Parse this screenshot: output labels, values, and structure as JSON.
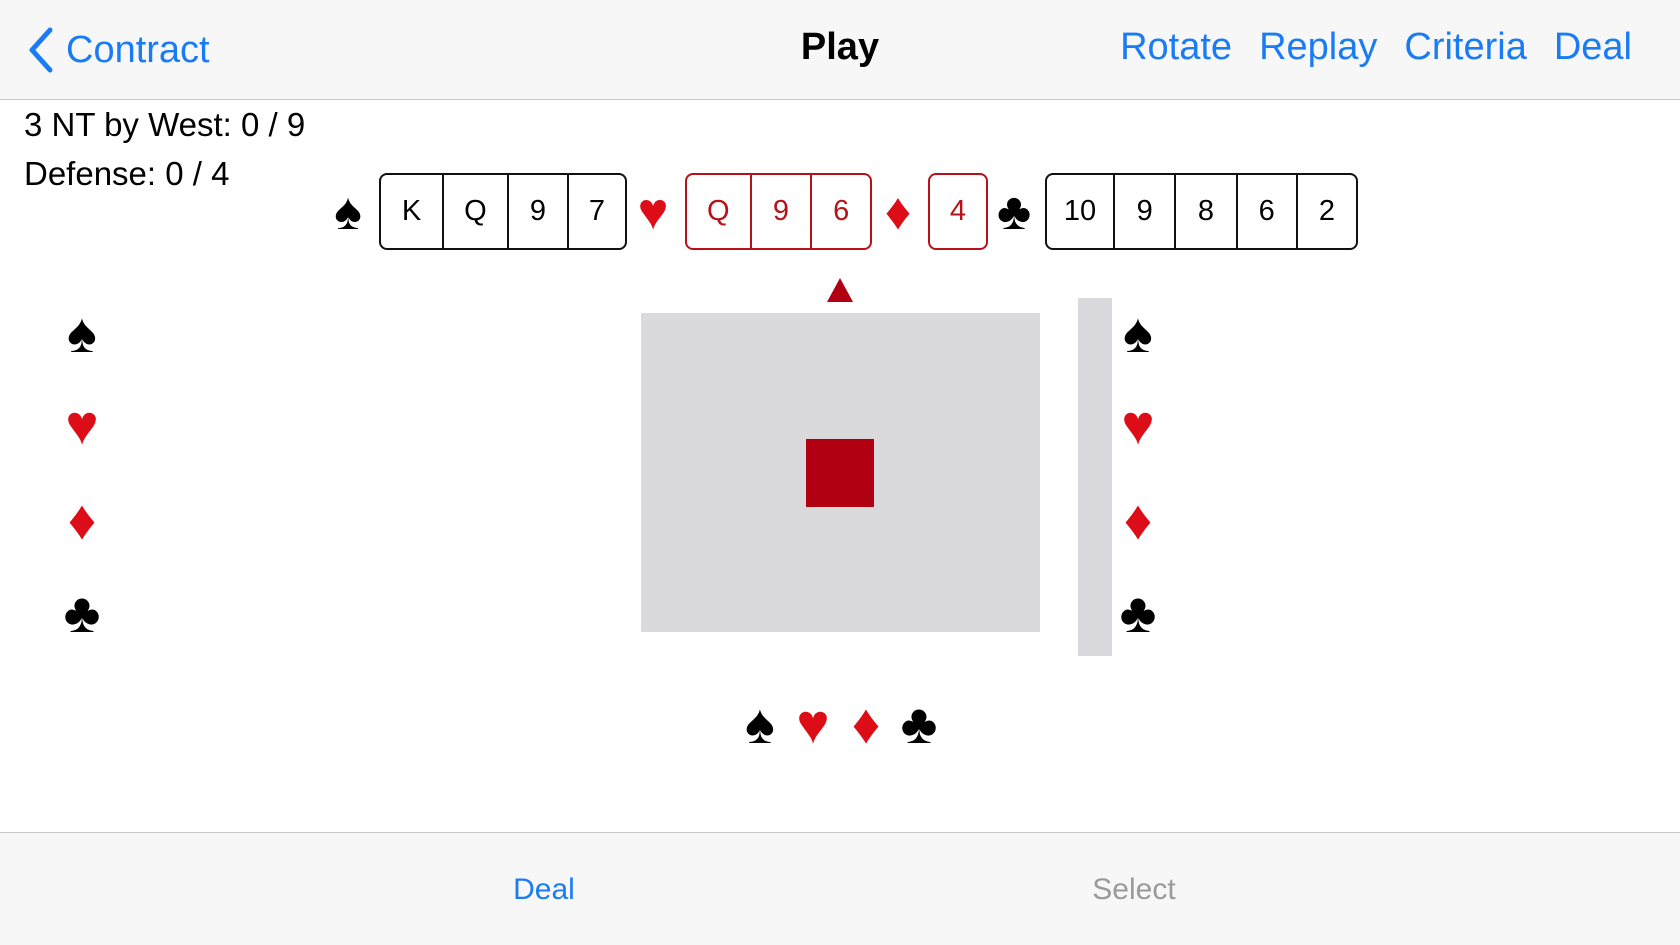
{
  "navbar": {
    "back_label": "Contract",
    "title": "Play",
    "actions": [
      "Rotate",
      "Replay",
      "Criteria",
      "Deal"
    ]
  },
  "info": {
    "contract_line": "3 NT by West: 0 / 9",
    "defense_line": "Defense: 0 / 4"
  },
  "north_hand": {
    "spades": [
      "K",
      "Q",
      "9",
      "7"
    ],
    "hearts": [
      "Q",
      "9",
      "6"
    ],
    "diamonds": [
      "4"
    ],
    "clubs": [
      "10",
      "9",
      "8",
      "6",
      "2"
    ]
  },
  "suit_symbols": {
    "spade": "♠",
    "heart": "♥",
    "diamond": "♦",
    "club": "♣"
  },
  "tabbar": {
    "deal_label": "Deal",
    "select_label": "Select"
  },
  "colors": {
    "accent": "#1a7cf5",
    "red_suit": "#dd0d17",
    "card_red": "#b5121b",
    "marker": "#b10012",
    "table": "#dadadd",
    "disabled": "#9a9a9a"
  }
}
